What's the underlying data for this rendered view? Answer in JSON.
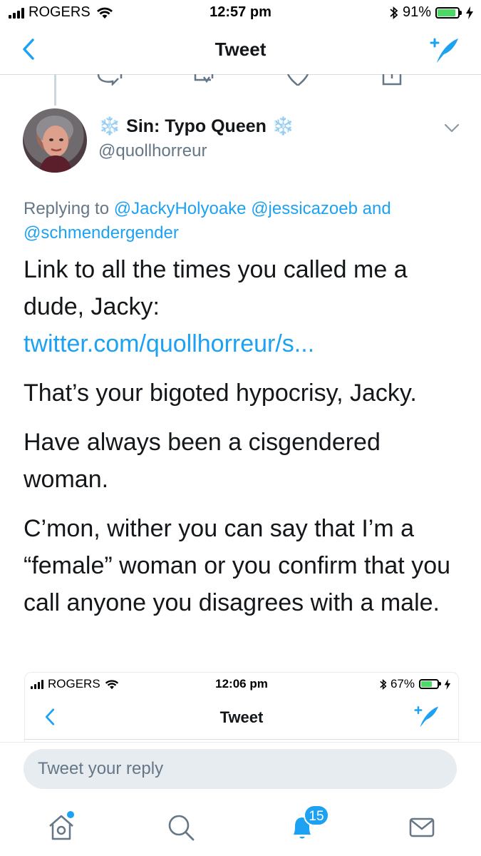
{
  "status_bar": {
    "carrier": "ROGERS",
    "time": "12:57 pm",
    "battery_percent": "91%",
    "battery_level": 0.91,
    "icons": [
      "signal-icon",
      "wifi-icon",
      "bluetooth-icon",
      "battery-icon",
      "charging-icon"
    ]
  },
  "navbar": {
    "title": "Tweet",
    "back_icon": "back-chevron-icon",
    "compose_icon": "compose-tweet-icon"
  },
  "tweet": {
    "author": {
      "display_name": "Sin: Typo Queen",
      "handle": "@quollhorreur",
      "name_emoji": "❄️"
    },
    "replying_prefix": "Replying to",
    "mentions": [
      "@JackyHolyoake",
      "@jessicazoeb"
    ],
    "mentions_joiner": "and",
    "mentions_last": "@schmendergender",
    "paragraphs": {
      "p1_text": "Link to all the times you called me a dude, Jacky:",
      "p1_link": "twitter.com/quollhorreur/s...",
      "p2": "That’s your bigoted hypocrisy, Jacky.",
      "p3": "Have always been a cisgendered woman.",
      "p4": "C’mon, wither you can say that I’m a “female” woman or you confirm that you call anyone you disagrees with a male."
    }
  },
  "embedded_screenshot": {
    "carrier": "ROGERS",
    "time": "12:06 pm",
    "battery_percent": "67%",
    "battery_level": 0.67,
    "title": "Tweet"
  },
  "reply": {
    "placeholder": "Tweet your reply"
  },
  "tabbar": {
    "tabs": [
      "home-icon",
      "search-icon",
      "notifications-icon",
      "messages-icon"
    ],
    "notification_count": "15"
  },
  "colors": {
    "accent": "#1da1f2",
    "secondary_text": "#657786",
    "primary_text": "#14171a",
    "input_bg": "#e6ecf0"
  }
}
